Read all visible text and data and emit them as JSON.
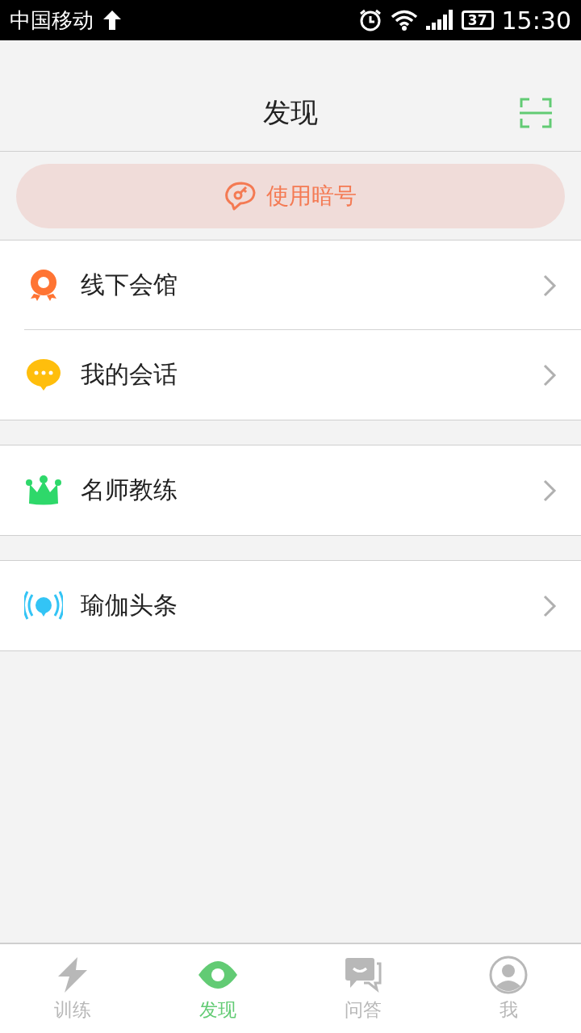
{
  "status_bar": {
    "carrier": "中国移动",
    "battery": "37",
    "time": "15:30"
  },
  "header": {
    "title": "发现"
  },
  "code_button": {
    "label": "使用暗号"
  },
  "groups": [
    {
      "items": [
        {
          "kind": "badge",
          "label": "线下会馆",
          "color": "#ff7433"
        },
        {
          "kind": "chat",
          "label": "我的会话",
          "color": "#ffbe0c"
        }
      ]
    },
    {
      "items": [
        {
          "kind": "crown",
          "label": "名师教练",
          "color": "#2ed86a"
        }
      ]
    },
    {
      "items": [
        {
          "kind": "broadcast",
          "label": "瑜伽头条",
          "color": "#33c4f5"
        }
      ]
    }
  ],
  "tabs": [
    {
      "kind": "bolt",
      "label": "训练",
      "selected": false
    },
    {
      "kind": "eye",
      "label": "发现",
      "selected": true
    },
    {
      "kind": "qa",
      "label": "问答",
      "selected": false
    },
    {
      "kind": "person",
      "label": "我",
      "selected": false
    }
  ]
}
